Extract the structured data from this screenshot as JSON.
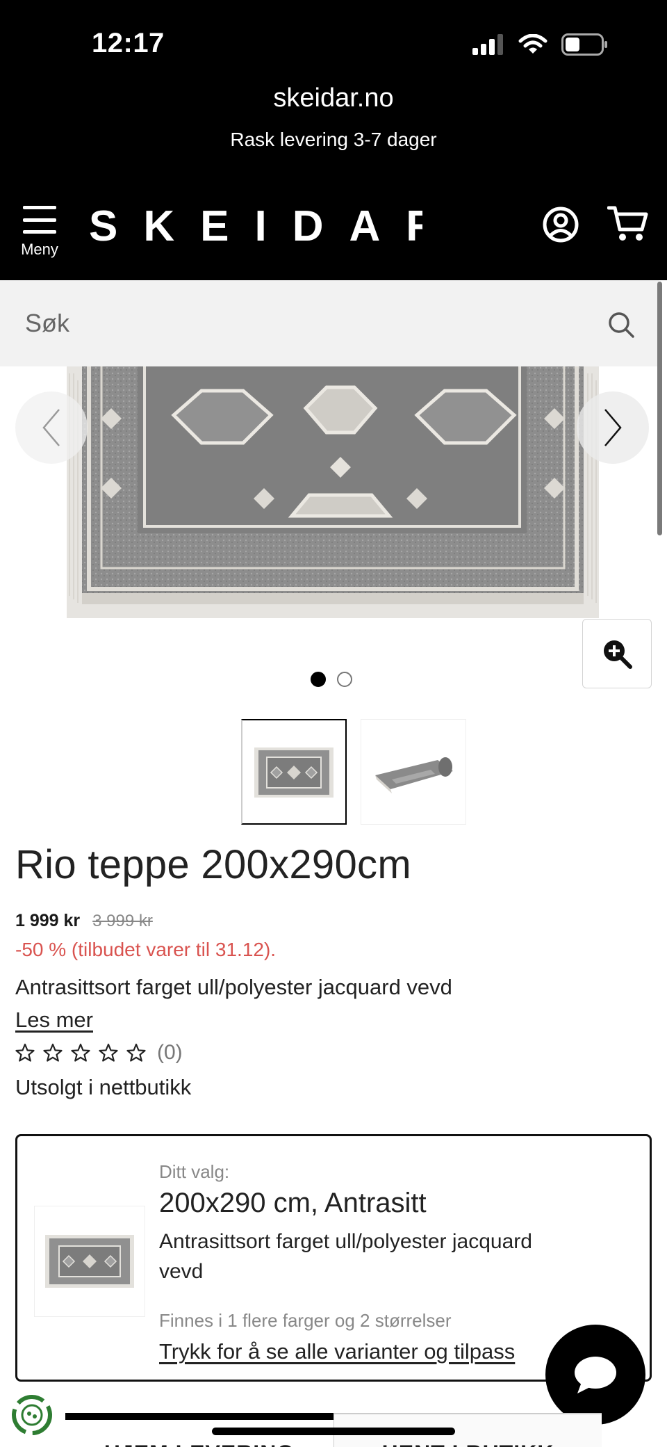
{
  "status_bar": {
    "time": "12:17"
  },
  "browser": {
    "url": "skeidar.no",
    "tagline": "Rask levering 3-7 dager"
  },
  "header": {
    "menu_label": "Meny",
    "logo_text": "SKEIDAR"
  },
  "search": {
    "placeholder": "Søk"
  },
  "gallery": {
    "image_count": 2,
    "active_index": 0
  },
  "product": {
    "title": "Rio teppe 200x290cm",
    "price": "1 999 kr",
    "old_price": "3 999 kr",
    "offer": "-50 % (tilbudet varer til 31.12).",
    "description": "Antrasittsort farget ull/polyester jacquard vevd",
    "read_more": "Les mer",
    "rating_stars": 0,
    "rating_count": "(0)",
    "stock_status": "Utsolgt i nettbutikk"
  },
  "variant": {
    "label": "Ditt valg:",
    "title": "200x290 cm, Antrasitt",
    "description": "Antrasittsort farget ull/polyester jacquard vevd",
    "more_info": "Finnes i 1 flere farger og 2 størrelser",
    "link": "Trykk for å se alle varianter og tilpass"
  },
  "delivery_tabs": {
    "home": "HJEM LEVERING",
    "store": "HENT I BUTIKK"
  },
  "colors": {
    "header_bg": "#000000",
    "search_bg": "#f2f2f2",
    "offer_red": "#d9534f"
  }
}
